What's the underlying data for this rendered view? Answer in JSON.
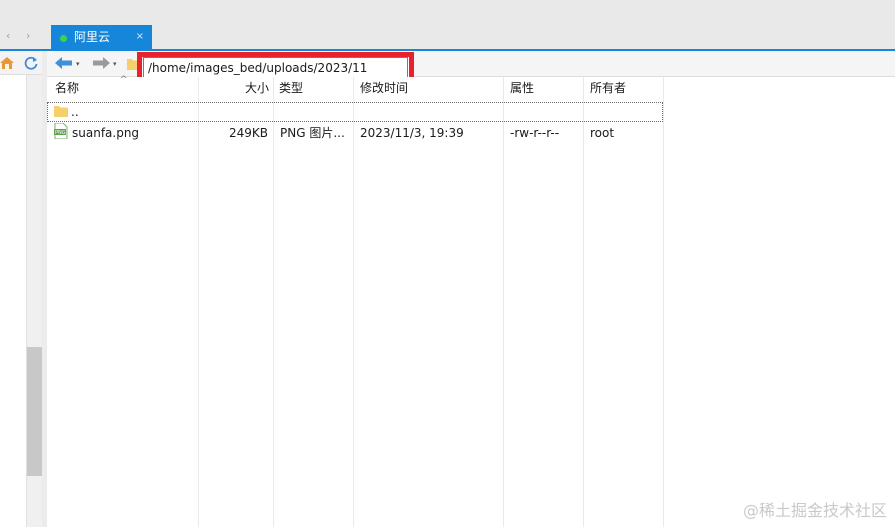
{
  "tabstrip": {
    "nav_left": "‹",
    "nav_right": "›",
    "active_tab": {
      "title": "阿里云",
      "close": "×",
      "status_color": "#37d64a"
    }
  },
  "toolbar": {
    "back_drop": "▾",
    "forward_drop": "▾",
    "path": "/home/images_bed/uploads/2023/11",
    "highlight_color": "#e8222d"
  },
  "file_list": {
    "columns": [
      "名称",
      "大小",
      "类型",
      "修改时间",
      "属性",
      "所有者"
    ],
    "sort_indicator": "^",
    "rows": [
      {
        "name": "..",
        "size": "",
        "type": "",
        "modified": "",
        "perms": "",
        "owner": "",
        "icon": "folder-icon"
      },
      {
        "name": "suanfa.png",
        "size": "249KB",
        "type": "PNG 图片...",
        "modified": "2023/11/3, 19:39",
        "perms": "-rw-r--r--",
        "owner": "root",
        "icon": "png-file-icon"
      }
    ]
  },
  "watermark": "@稀土掘金技术社区"
}
